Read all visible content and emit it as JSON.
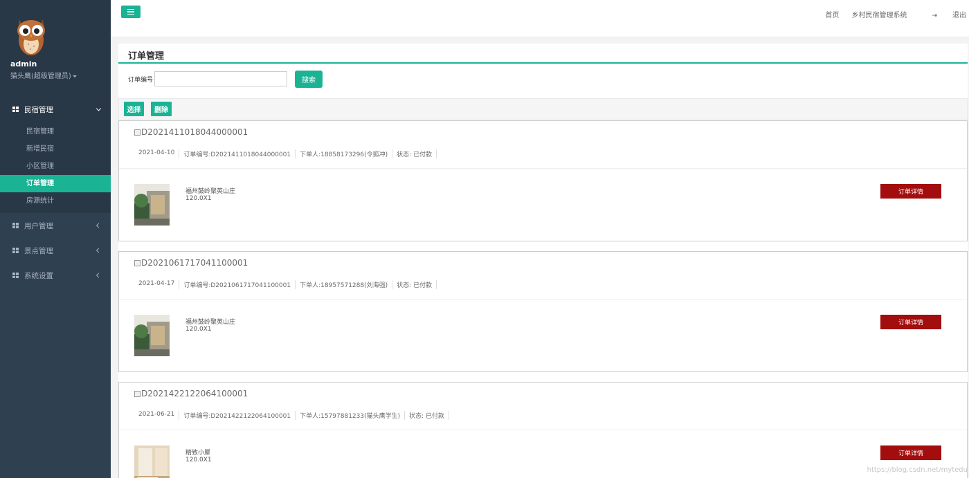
{
  "sidebar": {
    "user": {
      "name": "admin",
      "role": "猫头鹰(超级管理员)"
    },
    "groups": [
      {
        "label": "民宿管理",
        "open": true,
        "items": [
          "民宿管理",
          "新增民宿",
          "小区管理",
          "订单管理",
          "房源统计"
        ],
        "active": "订单管理"
      },
      {
        "label": "用户管理",
        "open": false
      },
      {
        "label": "景点管理",
        "open": false
      },
      {
        "label": "系统设置",
        "open": false
      }
    ]
  },
  "topbar": {
    "links": {
      "home": "首页",
      "system": "乡村民宿管理系统",
      "logout": "退出"
    }
  },
  "page": {
    "title": "订单管理",
    "search_label": "订单编号",
    "search_value": "",
    "search_button": "搜索",
    "select_button": "选择",
    "delete_button": "删除"
  },
  "orders": [
    {
      "id": "D2021411018044000001",
      "date": "2021-04-10",
      "order_no": "订单编号:D2021411018044000001",
      "buyer": "下单人:18858173296(令狐冲)",
      "status": "状态: 已付款",
      "item_name": "福州鼓岭聚英山庄",
      "item_qty": "120.0X1",
      "detail_button": "订单详情"
    },
    {
      "id": "D2021061717041100001",
      "date": "2021-04-17",
      "order_no": "订单编号:D2021061717041100001",
      "buyer": "下单人:18957571288(刘海强)",
      "status": "状态: 已付款",
      "item_name": "福州鼓岭聚英山庄",
      "item_qty": "120.0X1",
      "detail_button": "订单详情"
    },
    {
      "id": "D2021422122064100001",
      "date": "2021-06-21",
      "order_no": "订单编号:D2021422122064100001",
      "buyer": "下单人:15797881233(猫头鹰学生)",
      "status": "状态: 已付款",
      "item_name": "精致小屋",
      "item_qty": "120.0X1",
      "detail_button": "订单详情"
    }
  ],
  "watermark": "https://blog.csdn.net/mytedu",
  "colors": {
    "sidebar": "#2f4050",
    "accent": "#1ab394",
    "detail": "#a30d0d"
  }
}
